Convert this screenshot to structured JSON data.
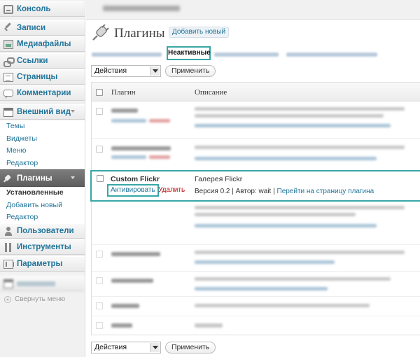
{
  "sidebar": {
    "items": [
      {
        "label": "Консоль",
        "icon": "dashboard-icon"
      },
      {
        "label": "Записи",
        "icon": "pushpin-icon"
      },
      {
        "label": "Медиафайлы",
        "icon": "media-icon"
      },
      {
        "label": "Ссылки",
        "icon": "links-icon"
      },
      {
        "label": "Страницы",
        "icon": "pages-icon"
      },
      {
        "label": "Комментарии",
        "icon": "comments-icon"
      },
      {
        "label": "Внешний вид",
        "icon": "appearance-icon"
      },
      {
        "label": "Плагины",
        "icon": "plugin-icon"
      },
      {
        "label": "Пользователи",
        "icon": "users-icon"
      },
      {
        "label": "Инструменты",
        "icon": "tools-icon"
      },
      {
        "label": "Параметры",
        "icon": "settings-icon"
      }
    ],
    "appearance_submenu": [
      "Темы",
      "Виджеты",
      "Меню",
      "Редактор"
    ],
    "plugins_submenu": [
      "Установленные",
      "Добавить новый",
      "Редактор"
    ],
    "collapse_label": "Свернуть меню"
  },
  "header": {
    "title": "Плагины",
    "add_new": "Добавить новый"
  },
  "filters": {
    "inactive": "Неактивные"
  },
  "bulk": {
    "select_value": "Действия",
    "apply": "Применить"
  },
  "table": {
    "col_plugin": "Плагин",
    "col_description": "Описание"
  },
  "active_row": {
    "name": "Custom Flickr",
    "activate": "Активировать",
    "delete": "Удалить",
    "description": "Галерея Flickr",
    "version": "Версия 0.2",
    "author": "Автор: wait",
    "plugin_link": "Перейти на страницу плагина",
    "separator": " | "
  },
  "colors": {
    "link": "#21759b",
    "highlight": "#38a6a6",
    "delete": "#bc0b0b"
  }
}
